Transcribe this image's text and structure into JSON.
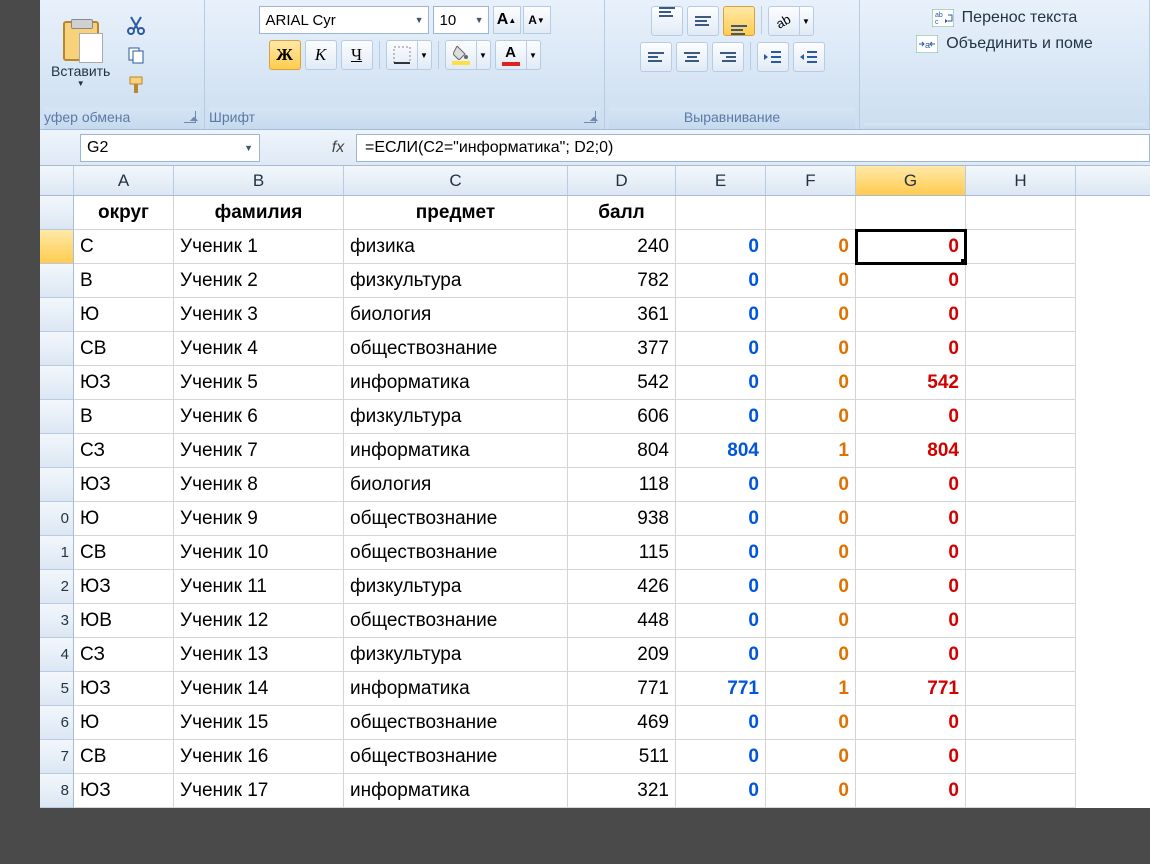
{
  "ribbon": {
    "clipboard": {
      "paste": "Вставить",
      "label": "уфер обмена"
    },
    "font": {
      "name": "ARIAL Cyr",
      "size": "10",
      "bold": "Ж",
      "italic": "К",
      "underline": "Ч",
      "bigA": "A",
      "smallA": "A",
      "label": "Шрифт"
    },
    "align": {
      "label": "Выравнивание"
    },
    "merge": {
      "wrap": "Перенос текста",
      "merge": "Объединить и поме"
    }
  },
  "formula": {
    "cell_ref": "G2",
    "fx": "fx",
    "value": "=ЕСЛИ(C2=\"информатика\"; D2;0)"
  },
  "columns": [
    "A",
    "B",
    "C",
    "D",
    "E",
    "F",
    "G",
    "H"
  ],
  "headers": {
    "A": "округ",
    "B": "фамилия",
    "C": "предмет",
    "D": "балл"
  },
  "rows": [
    {
      "n": "",
      "A": "С",
      "B": "Ученик 1",
      "C": "физика",
      "D": "240",
      "E": "0",
      "F": "0",
      "G": "0",
      "sel": true
    },
    {
      "n": "",
      "A": "В",
      "B": "Ученик 2",
      "C": "физкультура",
      "D": "782",
      "E": "0",
      "F": "0",
      "G": "0"
    },
    {
      "n": "",
      "A": "Ю",
      "B": "Ученик 3",
      "C": "биология",
      "D": "361",
      "E": "0",
      "F": "0",
      "G": "0"
    },
    {
      "n": "",
      "A": "СВ",
      "B": "Ученик 4",
      "C": "обществознание",
      "D": "377",
      "E": "0",
      "F": "0",
      "G": "0"
    },
    {
      "n": "",
      "A": "ЮЗ",
      "B": "Ученик 5",
      "C": "информатика",
      "D": "542",
      "E": "0",
      "F": "0",
      "G": "542"
    },
    {
      "n": "",
      "A": "В",
      "B": "Ученик 6",
      "C": "физкультура",
      "D": "606",
      "E": "0",
      "F": "0",
      "G": "0"
    },
    {
      "n": "",
      "A": "СЗ",
      "B": "Ученик 7",
      "C": "информатика",
      "D": "804",
      "E": "804",
      "F": "1",
      "G": "804"
    },
    {
      "n": "",
      "A": "ЮЗ",
      "B": "Ученик 8",
      "C": "биология",
      "D": "118",
      "E": "0",
      "F": "0",
      "G": "0"
    },
    {
      "n": "0",
      "A": "Ю",
      "B": "Ученик 9",
      "C": "обществознание",
      "D": "938",
      "E": "0",
      "F": "0",
      "G": "0"
    },
    {
      "n": "1",
      "A": "СВ",
      "B": "Ученик 10",
      "C": "обществознание",
      "D": "115",
      "E": "0",
      "F": "0",
      "G": "0"
    },
    {
      "n": "2",
      "A": "ЮЗ",
      "B": "Ученик 11",
      "C": "физкультура",
      "D": "426",
      "E": "0",
      "F": "0",
      "G": "0"
    },
    {
      "n": "3",
      "A": "ЮВ",
      "B": "Ученик 12",
      "C": "обществознание",
      "D": "448",
      "E": "0",
      "F": "0",
      "G": "0"
    },
    {
      "n": "4",
      "A": "СЗ",
      "B": "Ученик 13",
      "C": "физкультура",
      "D": "209",
      "E": "0",
      "F": "0",
      "G": "0"
    },
    {
      "n": "5",
      "A": "ЮЗ",
      "B": "Ученик 14",
      "C": "информатика",
      "D": "771",
      "E": "771",
      "F": "1",
      "G": "771"
    },
    {
      "n": "6",
      "A": "Ю",
      "B": "Ученик 15",
      "C": "обществознание",
      "D": "469",
      "E": "0",
      "F": "0",
      "G": "0"
    },
    {
      "n": "7",
      "A": "СВ",
      "B": "Ученик 16",
      "C": "обществознание",
      "D": "511",
      "E": "0",
      "F": "0",
      "G": "0"
    },
    {
      "n": "8",
      "A": "ЮЗ",
      "B": "Ученик 17",
      "C": "информатика",
      "D": "321",
      "E": "0",
      "F": "0",
      "G": "0"
    }
  ]
}
